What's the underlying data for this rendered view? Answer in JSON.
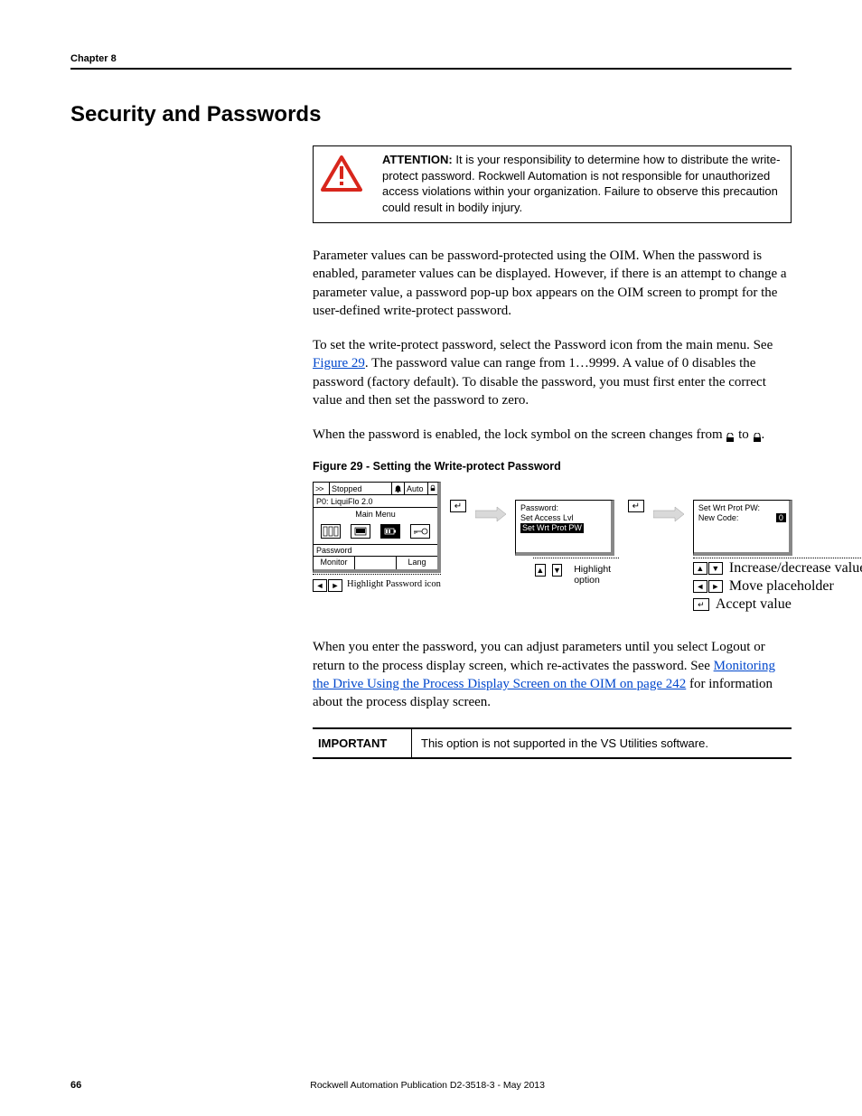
{
  "header": {
    "chapter": "Chapter 8"
  },
  "h1": "Security and Passwords",
  "attention": {
    "label": "ATTENTION:",
    "text": " It is your responsibility to determine how to distribute the write-protect password. Rockwell Automation is not responsible for unauthorized access violations within your organization. Failure to observe this precaution could result in bodily injury."
  },
  "para1": "Parameter values can be password-protected using the OIM. When the password is enabled, parameter values can be displayed. However, if there is an attempt to change a parameter value, a password pop-up box appears on the OIM screen to prompt for the user-defined write-protect password.",
  "para2a": "To set the write-protect password, select the Password icon from the main menu. See ",
  "para2link": "Figure 29",
  "para2b": ". The password value can range from 1…9999. A value of 0 disables the password (factory default). To disable the password, you must first enter the correct value and then set the password to zero.",
  "para3a": "When the password is enabled, the lock symbol on the screen changes from ",
  "para3b": " to ",
  "para3c": ".",
  "figtitle": "Figure 29 - Setting the Write-protect Password",
  "oim": {
    "status": "Stopped",
    "mode": "Auto",
    "port": "P0: LiquiFlo 2.0",
    "menu": "Main Menu",
    "pw": "Password",
    "foot_l": "Monitor",
    "foot_r": "Lang"
  },
  "oim_under": "Highlight Password icon",
  "oim2": {
    "l1": "Password:",
    "l2": "Set Access Lvl",
    "l3": "Set Wrt Prot PW"
  },
  "oim2_under": "Highlight option",
  "oim3": {
    "l1": "Set Wrt Prot PW:",
    "l2": "New Code:",
    "val": "0"
  },
  "oim3_under": {
    "a": "Increase/decrease value",
    "b": "Move placeholder",
    "c": "Accept value"
  },
  "para4a": "When you enter the password, you can adjust parameters until you select Logout or return to the process display screen, which re-activates the password. See ",
  "para4link": "Monitoring the Drive Using the Process Display Screen on the OIM on page 242",
  "para4b": " for information about the process display screen.",
  "important": {
    "label": "IMPORTANT",
    "text": "This option is not supported in the VS Utilities software."
  },
  "footer": {
    "page": "66",
    "pub": "Rockwell Automation Publication D2-3518-3 - May 2013"
  }
}
